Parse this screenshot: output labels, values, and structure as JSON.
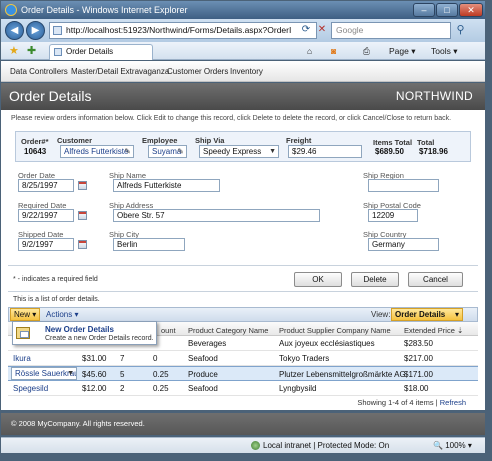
{
  "window": {
    "title": "Order Details - Windows Internet Explorer",
    "min": "–",
    "max": "□",
    "close": "✕"
  },
  "address_bar": {
    "url": "http://localhost:51923/Northwind/Forms/Details.aspx?OrderI",
    "search_placeholder": "Google"
  },
  "tab": {
    "label": "Order Details"
  },
  "commands": {
    "page": "Page",
    "tools": "Tools"
  },
  "menu": [
    "Data Controllers",
    "Master/Detail Extravaganza",
    "Customer Orders",
    "Inventory"
  ],
  "header": {
    "title": "Order Details",
    "brand": "NORTHWIND"
  },
  "description": "Please review orders information below. Click Edit to change this record, click Delete to delete the record, or click Cancel/Close to return back.",
  "summary": {
    "order_label": "Order#*",
    "order_value": "10643",
    "customer_label": "Customer",
    "customer_value": "Alfreds Futterkiste",
    "employee_label": "Employee",
    "employee_value": "Suyama",
    "shipvia_label": "Ship Via",
    "shipvia_value": "Speedy Express",
    "freight_label": "Freight",
    "freight_value": "$29.46",
    "itemstotal_label": "Items Total",
    "itemstotal_value": "$689.50",
    "total_label": "Total",
    "total_value": "$718.96"
  },
  "fields": {
    "order_date_label": "Order Date",
    "order_date": "8/25/1997",
    "ship_name_label": "Ship Name",
    "ship_name": "Alfreds Futterkiste",
    "ship_region_label": "Ship Region",
    "ship_region": "",
    "required_date_label": "Required Date",
    "required_date": "9/22/1997",
    "ship_address_label": "Ship Address",
    "ship_address": "Obere Str. 57",
    "ship_postal_label": "Ship Postal Code",
    "ship_postal": "12209",
    "shipped_date_label": "Shipped Date",
    "shipped_date": "9/2/1997",
    "ship_city_label": "Ship City",
    "ship_city": "Berlin",
    "ship_country_label": "Ship Country",
    "ship_country": "Germany"
  },
  "required_note": "* - indicates a required field",
  "buttons": {
    "ok": "OK",
    "delete": "Delete",
    "cancel": "Cancel"
  },
  "list_note": "This is a list of order details.",
  "grid_toolbar": {
    "new": "New",
    "actions": "Actions",
    "view_label": "View:",
    "view_value": "Order Details"
  },
  "popup": {
    "title": "New Order Details",
    "subtitle": "Create a new Order Details record."
  },
  "grid": {
    "headers": {
      "discount_tail": "ount",
      "category": "Product Category Name",
      "supplier": "Product Supplier Company Name",
      "extended": "Extended Price"
    },
    "rows": [
      {
        "product": "",
        "price": "",
        "qty": "",
        "discount": "",
        "category": "Beverages",
        "supplier": "Aux joyeux ecclésiastiques",
        "extended": "$283.50"
      },
      {
        "product": "Ikura",
        "price": "$31.00",
        "qty": "7",
        "discount": "0",
        "category": "Seafood",
        "supplier": "Tokyo Traders",
        "extended": "$217.00"
      },
      {
        "product": "Rössle Sauerkraut",
        "price": "$45.60",
        "qty": "5",
        "discount": "0.25",
        "category": "Produce",
        "supplier": "Plutzer Lebensmittelgroßmärkte AG",
        "extended": "$171.00"
      },
      {
        "product": "Spegesild",
        "price": "$12.00",
        "qty": "2",
        "discount": "0.25",
        "category": "Seafood",
        "supplier": "Lyngbysild",
        "extended": "$18.00"
      }
    ]
  },
  "pager": {
    "text": "Showing 1-4 of 4 items |",
    "refresh": "Refresh"
  },
  "footer": "© 2008 MyCompany. All rights reserved.",
  "status": {
    "zone": "Local intranet | Protected Mode: On",
    "zoom": "100%"
  }
}
